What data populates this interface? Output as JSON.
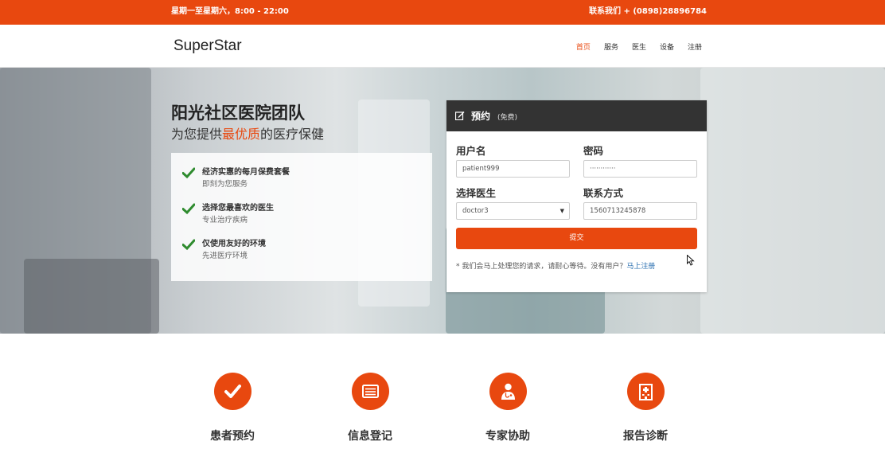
{
  "topbar": {
    "hours": "星期一至星期六，8:00 - 22:00",
    "contact": "联系我们 + (0898)28896784"
  },
  "nav": {
    "brand": "SuperStar",
    "items": [
      "首页",
      "服务",
      "医生",
      "设备",
      "注册"
    ],
    "active_index": 0
  },
  "hero": {
    "title": "阳光社区医院团队",
    "subtitle_pre": "为您提供",
    "subtitle_highlight": "最优质",
    "subtitle_post": "的医疗保健",
    "features": [
      {
        "title": "经济实惠的每月保费套餐",
        "desc": "即刻为您服务",
        "icon": "check-icon"
      },
      {
        "title": "选择您最喜欢的医生",
        "desc": "专业治疗疾病",
        "icon": "check-icon"
      },
      {
        "title": "仅使用友好的环境",
        "desc": "先进医疗环境",
        "icon": "check-icon"
      }
    ]
  },
  "form": {
    "title": "预约",
    "free_tag": "(免费)",
    "username_label": "用户名",
    "username_value": "patient999",
    "password_label": "密码",
    "password_value": "············",
    "doctor_label": "选择医生",
    "doctor_value": "doctor3",
    "contact_label": "联系方式",
    "contact_value": "1560713245878",
    "submit_label": "提交",
    "note_text": "* 我们会马上处理您的请求，请耐心等待。没有用户？",
    "note_link": "马上注册"
  },
  "services": [
    {
      "label": "患者预约",
      "icon": "check-icon"
    },
    {
      "label": "信息登记",
      "icon": "form-icon"
    },
    {
      "label": "专家协助",
      "icon": "doctor-icon"
    },
    {
      "label": "报告诊断",
      "icon": "hospital-icon"
    }
  ],
  "colors": {
    "accent": "#e8480f",
    "panel_header": "#333333",
    "check_green": "#2e8b2e",
    "link": "#2a6fb0"
  }
}
